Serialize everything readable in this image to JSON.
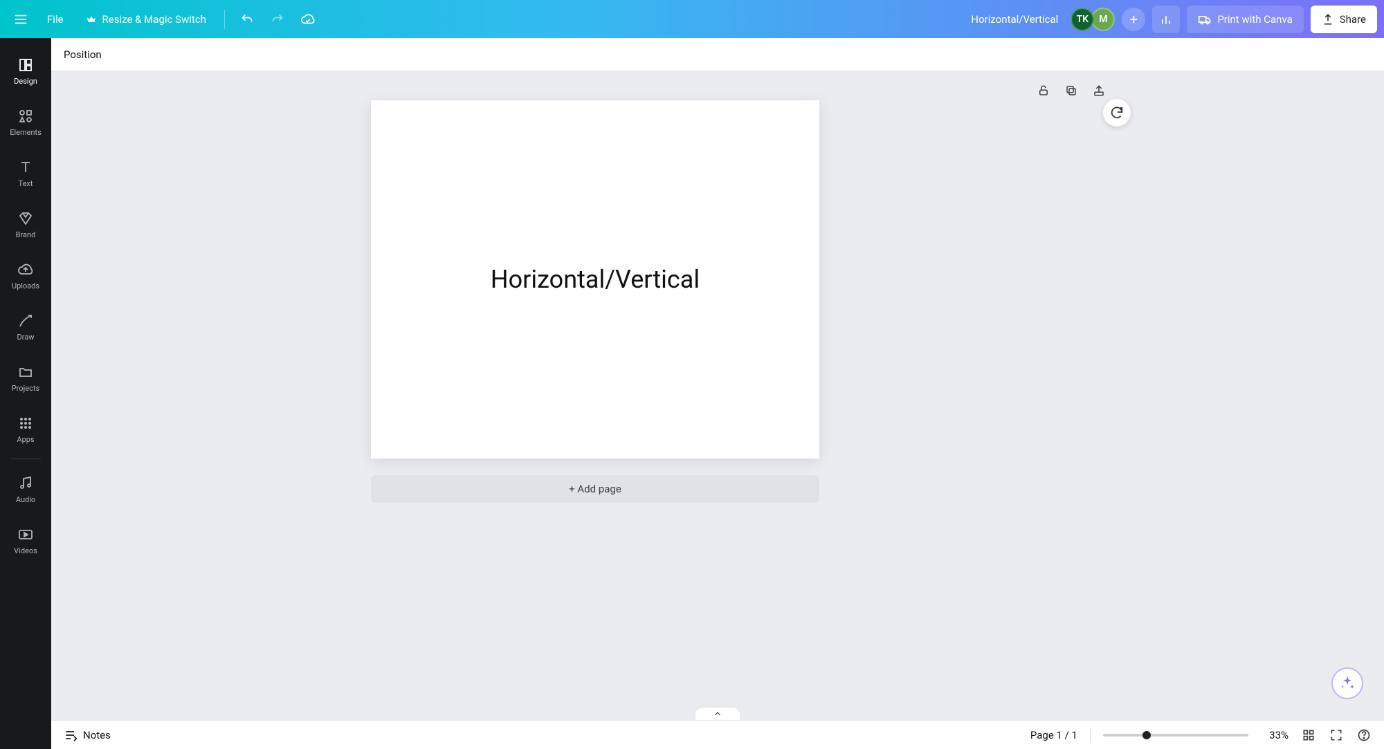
{
  "header": {
    "file_label": "File",
    "resize_label": "Resize & Magic Switch",
    "doc_title": "Horizontal/Vertical",
    "avatars": {
      "a1": "TK",
      "a2": "M"
    },
    "print_label": "Print with Canva",
    "share_label": "Share"
  },
  "subtoolbar": {
    "position_label": "Position"
  },
  "sidebar": {
    "items": [
      {
        "label": "Design"
      },
      {
        "label": "Elements"
      },
      {
        "label": "Text"
      },
      {
        "label": "Brand"
      },
      {
        "label": "Uploads"
      },
      {
        "label": "Draw"
      },
      {
        "label": "Projects"
      },
      {
        "label": "Apps"
      },
      {
        "label": "Audio"
      },
      {
        "label": "Videos"
      }
    ]
  },
  "canvas": {
    "page_text": "Horizontal/Vertical",
    "add_page_label": "+ Add page"
  },
  "bottom": {
    "notes_label": "Notes",
    "page_indicator": "Page 1 / 1",
    "zoom_label": "33%"
  }
}
